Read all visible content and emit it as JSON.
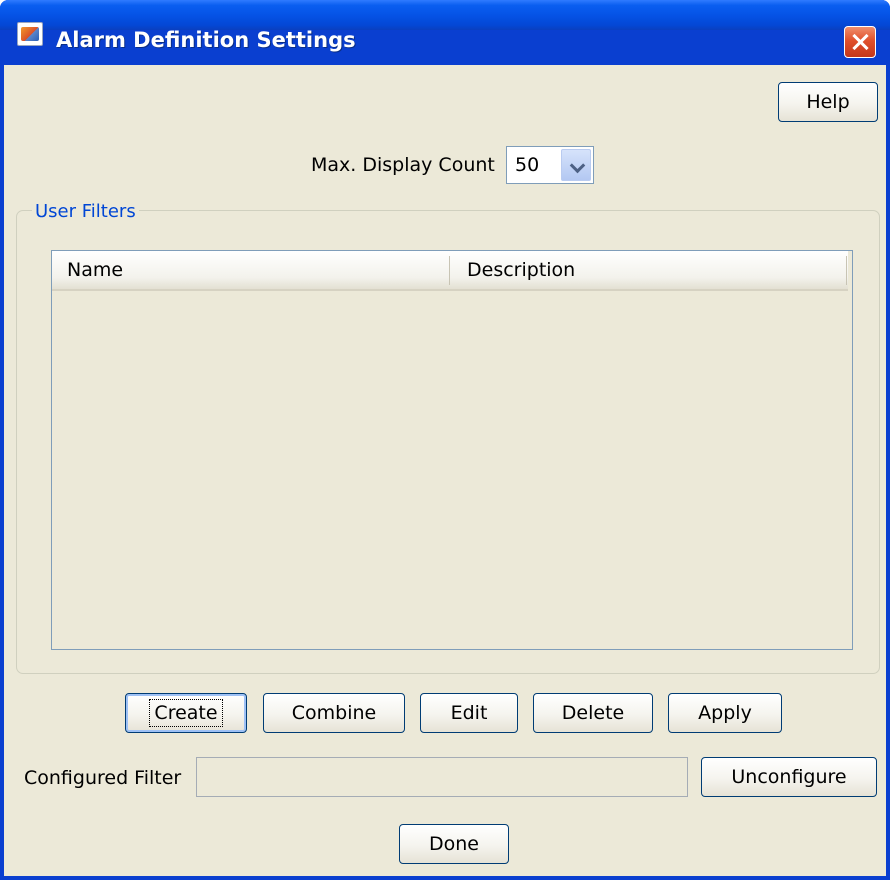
{
  "window": {
    "title": "Alarm Definition Settings",
    "close_icon": "close-icon",
    "app_icon": "java-app-icon"
  },
  "toolbar": {
    "help_label": "Help"
  },
  "display": {
    "max_display_count_label": "Max. Display Count",
    "max_display_count_value": "50",
    "dropdown_icon": "chevron-down-icon"
  },
  "user_filters": {
    "legend": "User Filters",
    "columns": [
      "Name",
      "Description"
    ],
    "rows": []
  },
  "actions": {
    "create_label": "Create",
    "combine_label": "Combine",
    "edit_label": "Edit",
    "delete_label": "Delete",
    "apply_label": "Apply"
  },
  "configured_filter": {
    "label": "Configured Filter",
    "value": "",
    "unconfigure_label": "Unconfigure"
  },
  "footer": {
    "done_label": "Done"
  },
  "colors": {
    "title_bar": "#0553e6",
    "client_bg": "#ece9d8",
    "legend_text": "#0046d5",
    "close_button": "#e0502c"
  }
}
